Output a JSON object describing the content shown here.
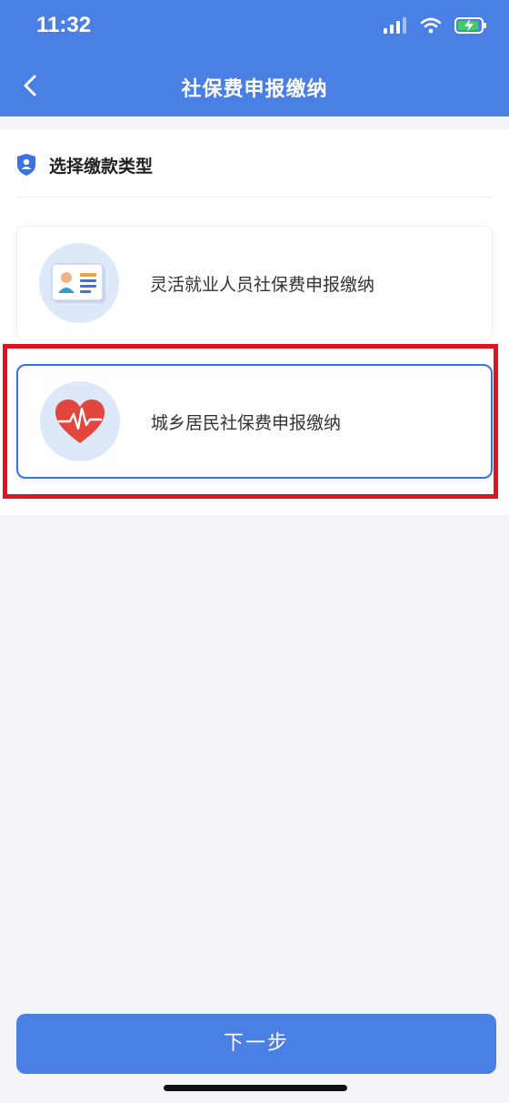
{
  "status_bar": {
    "time": "11:32",
    "icons": [
      "signal-icon",
      "wifi-icon",
      "battery-charging-icon"
    ]
  },
  "nav": {
    "title": "社保费申报缴纳",
    "back_icon": "chevron-left-icon"
  },
  "section": {
    "title": "选择缴款类型",
    "icon": "shield-user-icon"
  },
  "options": [
    {
      "label": "灵活就业人员社保费申报缴纳",
      "icon": "id-card-icon",
      "selected": false
    },
    {
      "label": "城乡居民社保费申报缴纳",
      "icon": "heart-pulse-icon",
      "selected": true
    }
  ],
  "next_button": {
    "label": "下一步"
  },
  "colors": {
    "brand": "#4a7fe3",
    "selected_border": "#3a73e0",
    "highlight": "#e0141e",
    "background": "#f4f5f8"
  }
}
